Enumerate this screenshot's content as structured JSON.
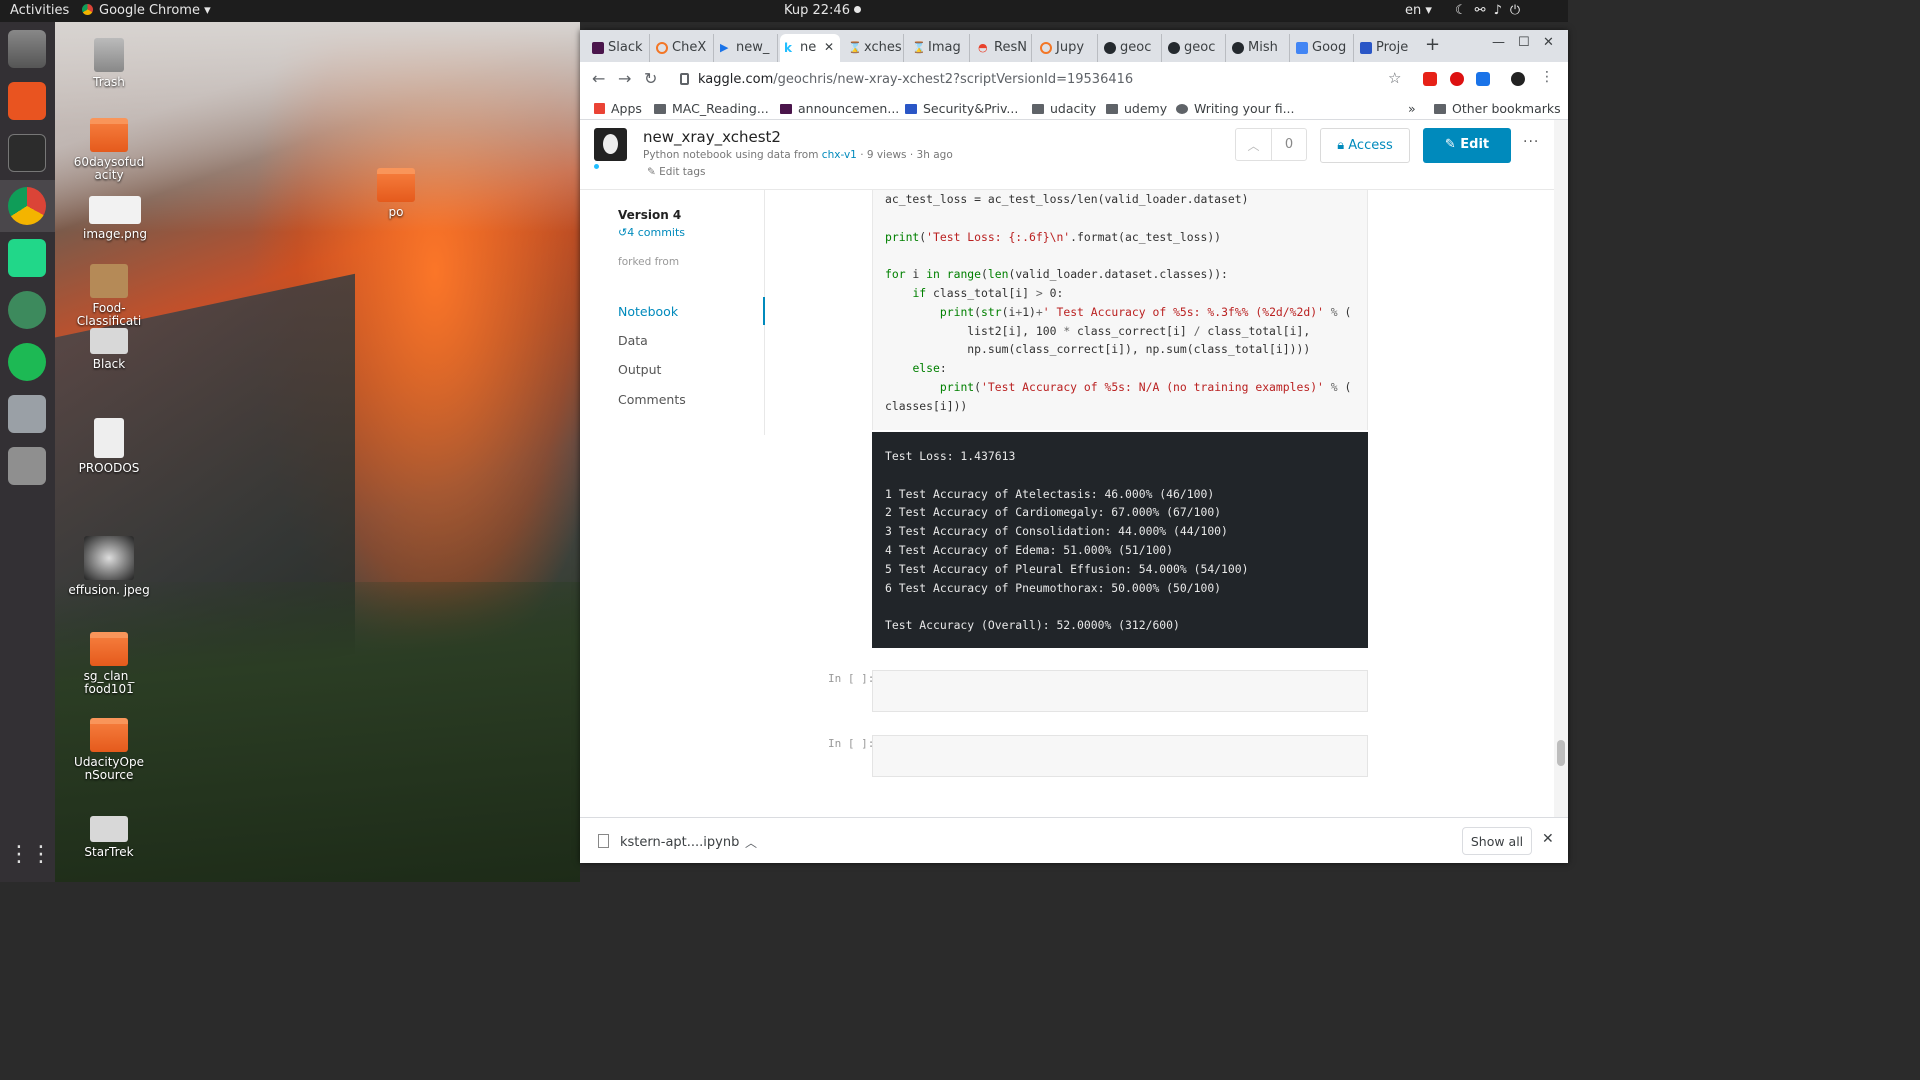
{
  "topbar": {
    "activities": "Activities",
    "app_menu": "Google Chrome ▾",
    "clock": "Kup 22:46",
    "lang": "en ▾"
  },
  "desktop_icons": [
    {
      "label": "Trash"
    },
    {
      "label": "60daysofud acity"
    },
    {
      "label": "image.png"
    },
    {
      "label": "Food-Classificati on-..."
    },
    {
      "label": "Black"
    },
    {
      "label": "PROODOS"
    },
    {
      "label": "effusion. jpeg"
    },
    {
      "label": "sg_clan_ food101"
    },
    {
      "label": "UdacityOpe nSource"
    },
    {
      "label": "StarTrek"
    },
    {
      "label": "po"
    }
  ],
  "tabs": [
    "Slack",
    "CheX",
    "new_",
    "ne",
    "xches",
    "Imag",
    "ResN",
    "Jupy",
    "geoc",
    "geoc",
    "Mish",
    "Goog",
    "Proje"
  ],
  "omnibox": {
    "host": "kaggle.com",
    "path": "/geochris/new-xray-xchest2?scriptVersionId=19536416"
  },
  "bookmarks": [
    "Apps",
    "MAC_Reading...",
    "announcemen...",
    "Security&Priv...",
    "udacity",
    "udemy",
    "Writing your fi...",
    "»",
    "Other bookmarks"
  ],
  "kernel": {
    "title": "new_xray_xchest2",
    "sub_prefix": "Python notebook using data from",
    "dataset": "chx-v1",
    "sub_suffix": "· 9 views · 3h ago",
    "edit_tags": "Edit tags",
    "votes": "0",
    "access": "Access",
    "edit": "Edit",
    "more": "···"
  },
  "sidebar": {
    "version": "Version 4",
    "commits": "4 commits",
    "forked_from": "forked from",
    "nav": [
      "Notebook",
      "Data",
      "Output",
      "Comments"
    ]
  },
  "output_lines": [
    "Test Loss: 1.437613",
    "",
    "1 Test Accuracy of Atelectasis: 46.000% (46/100)",
    "2 Test Accuracy of Cardiomegaly: 67.000% (67/100)",
    "3 Test Accuracy of Consolidation: 44.000% (44/100)",
    "4 Test Accuracy of Edema: 51.000% (51/100)",
    "5 Test Accuracy of Pleural Effusion: 54.000% (54/100)",
    "6 Test Accuracy of Pneumothorax: 50.000% (50/100)",
    "",
    "Test Accuracy (Overall): 52.0000% (312/600)"
  ],
  "in_prompt": "In [ ]:",
  "download": {
    "file": "kstern-apt....ipynb",
    "show_all": "Show all"
  }
}
